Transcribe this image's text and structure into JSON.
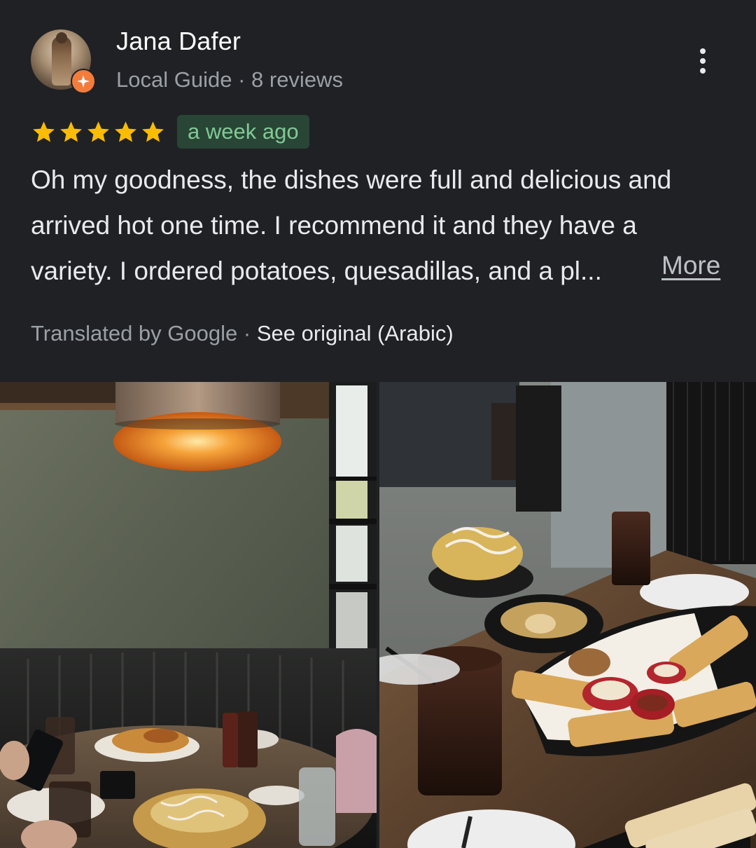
{
  "review": {
    "author": {
      "name": "Jana Dafer",
      "level": "Local Guide",
      "separator": " · ",
      "reviews": "8 reviews"
    },
    "rating": 5,
    "rating_max": 5,
    "time": "a week ago",
    "text_lines": [
      "Oh my goodness, the dishes were full and delicious and",
      "arrived hot one time. I recommend it and they have a",
      "variety. I ordered potatoes, quesadillas, and a pl..."
    ],
    "more_label": "More",
    "translation": {
      "note": "Translated by Google",
      "separator": " · ",
      "see_original": "See original (Arabic)"
    }
  },
  "icons": {
    "menu": "more-vert-icon",
    "badge": "local-guide-badge-icon",
    "star": "star-icon"
  },
  "colors": {
    "background": "#202124",
    "star": "#fbbc04",
    "chip_bg": "#294535",
    "chip_text": "#81c995",
    "badge": "#f37c3c"
  }
}
